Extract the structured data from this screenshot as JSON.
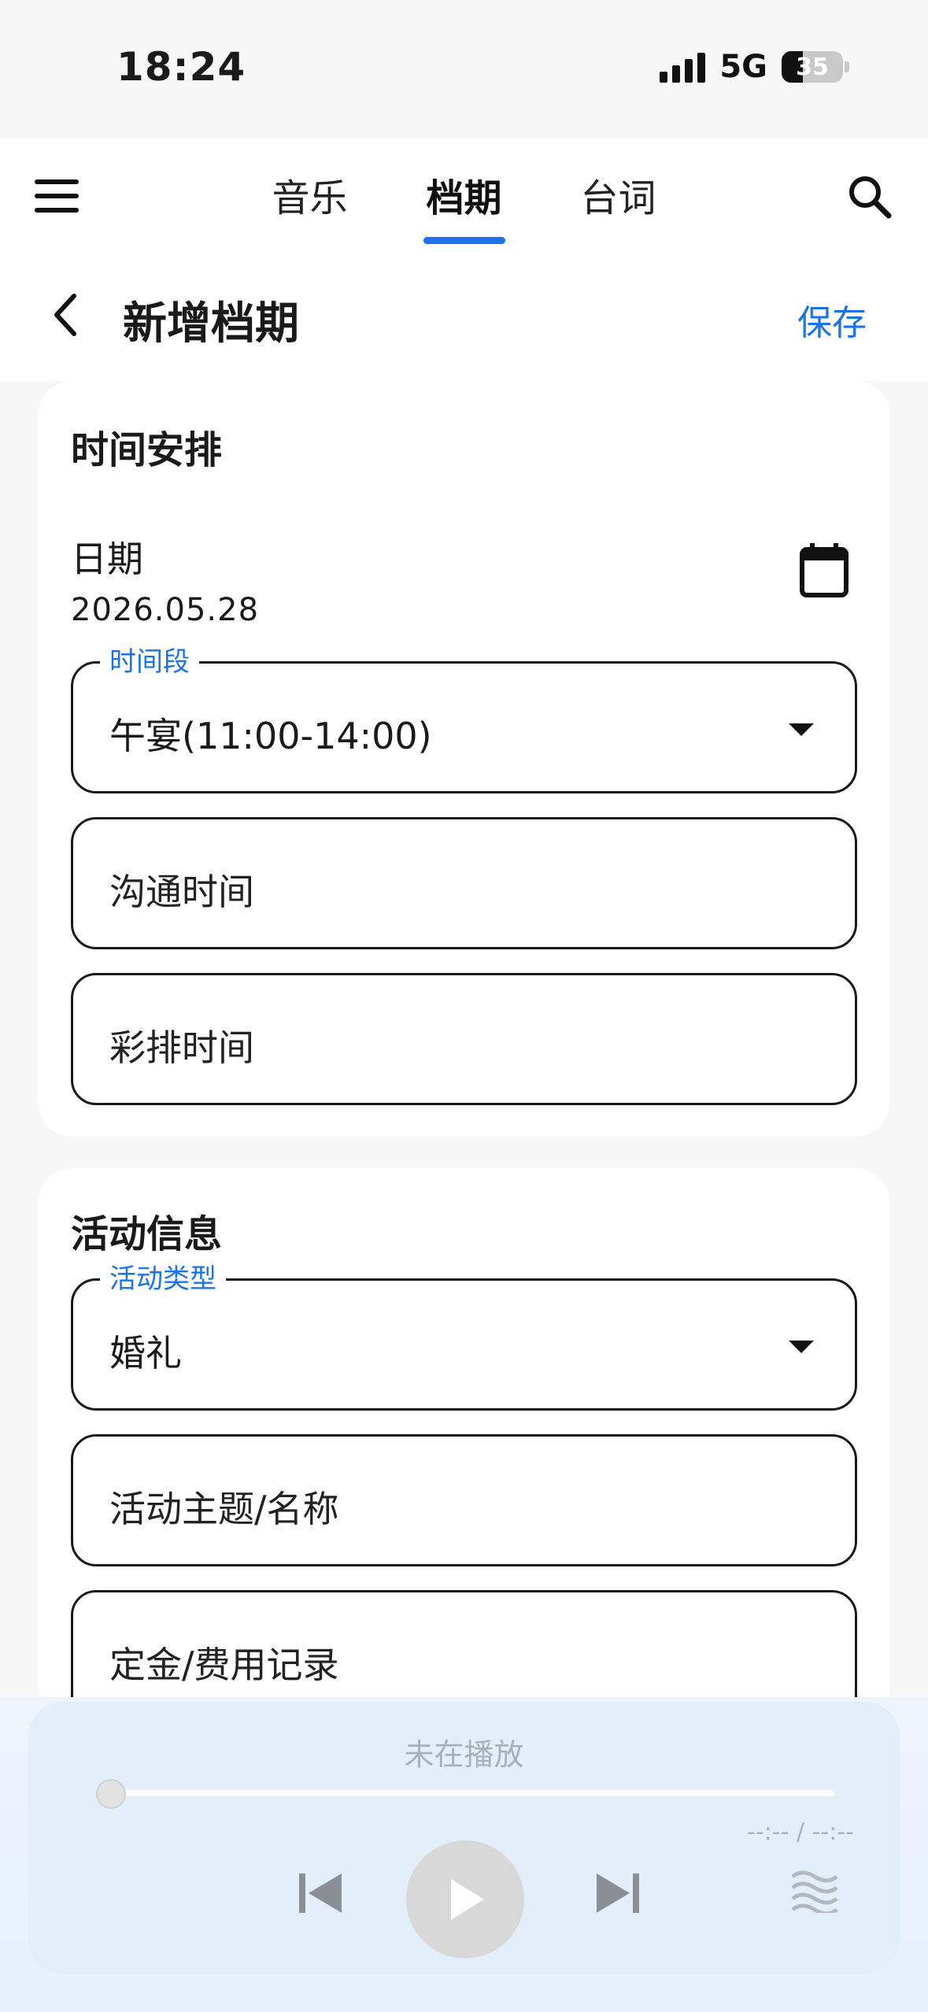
{
  "status_bar": {
    "time": "18:24",
    "network": "5G",
    "battery": "35"
  },
  "nav": {
    "tabs": [
      {
        "label": "音乐",
        "active": false
      },
      {
        "label": "档期",
        "active": true
      },
      {
        "label": "台词",
        "active": false
      }
    ],
    "menu_icon": "hamburger-icon",
    "search_icon": "search-icon",
    "accent_color": "#1a73e8"
  },
  "page": {
    "title": "新增档期",
    "back_icon": "chevron-left-icon",
    "save_label": "保存"
  },
  "schedule_card": {
    "title": "时间安排",
    "date_label": "日期",
    "date_value": "2026.05.28",
    "calendar_icon": "calendar-icon",
    "time_slot": {
      "label": "时间段",
      "value": "午宴(11:00-14:00)"
    },
    "communication_time": {
      "placeholder": "沟通时间"
    },
    "rehearsal_time": {
      "placeholder": "彩排时间"
    }
  },
  "activity_card": {
    "title": "活动信息",
    "activity_type": {
      "label": "活动类型",
      "value": "婚礼"
    },
    "theme_name": {
      "placeholder": "活动主题/名称"
    },
    "deposit": {
      "placeholder": "定金/费用记录"
    }
  },
  "player": {
    "status": "未在播放",
    "time_readout": "--:-- / --:--",
    "progress": 0,
    "icons": [
      "skip-previous-icon",
      "play-icon",
      "skip-next-icon",
      "waveform-icon"
    ]
  }
}
